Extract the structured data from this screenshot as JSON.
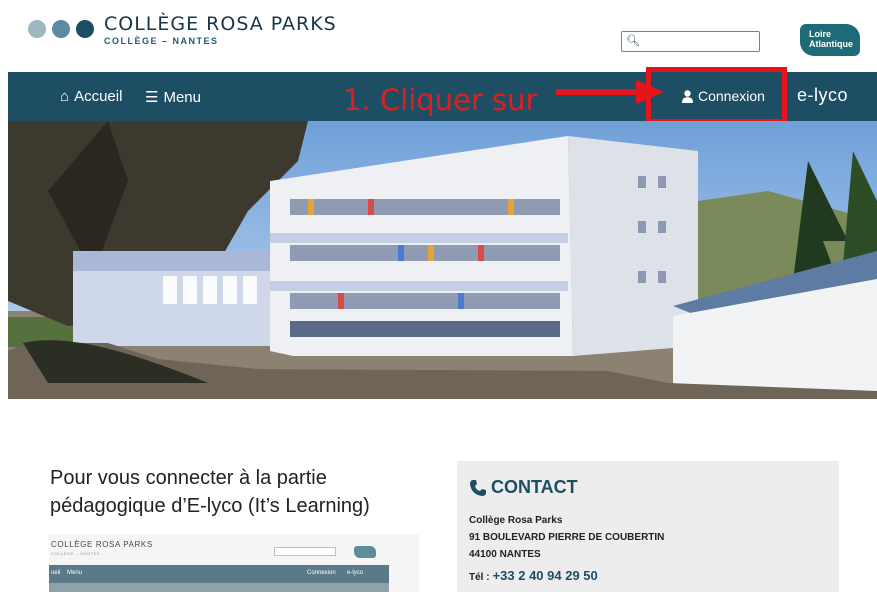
{
  "header": {
    "brand_title": "COLLÈGE ROSA PARKS",
    "brand_subtitle": "COLLÈGE – NANTES",
    "dot_colors": [
      "#9fb6c2",
      "#5d8aa0",
      "#1d4e63"
    ],
    "search": {
      "value": "",
      "placeholder": ""
    },
    "logo_text_line1": "Loire",
    "logo_text_line2": "Atlantique"
  },
  "nav": {
    "home_label": "Accueil",
    "menu_label": "Menu",
    "login_label": "Connexion",
    "elyco_label": "e-lyco",
    "bar_color": "#1d4e63"
  },
  "annotation": {
    "text": "1.  Cliquer sur",
    "color": "#e01e1e"
  },
  "content": {
    "heading_line1": "Pour vous connecter à la partie",
    "heading_line2": "pédagogique d’E-lyco (It’s Learning)",
    "thumbnail": {
      "brand": "COLLÈGE ROSA PARKS",
      "subtitle": "COLLÈGE – NANTES",
      "nav_home": "ueil",
      "nav_menu": "Menu",
      "nav_login": "Connexion",
      "nav_elyco": "e-lyco"
    }
  },
  "contact": {
    "title": "CONTACT",
    "name": "Collège Rosa Parks",
    "address": "91 BOULEVARD PIERRE DE COUBERTIN",
    "city": "44100 NANTES",
    "phone_label": "Tél :",
    "phone": "+33 2 40 94 29 50"
  }
}
